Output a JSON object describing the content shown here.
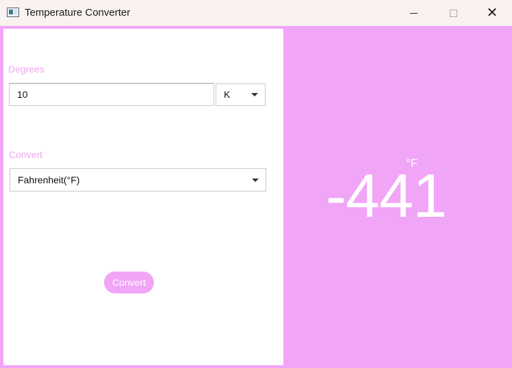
{
  "window": {
    "title": "Temperature Converter",
    "icon": "app-window-icon",
    "accent_color": "#f1a5f7"
  },
  "form": {
    "degrees_label": "Degrees",
    "degrees_value": "10",
    "source_unit": "K",
    "convert_label": "Convert",
    "target_unit": "Fahrenheit(°F)",
    "convert_button": "Convert"
  },
  "result": {
    "unit": "°F",
    "value": "-441"
  }
}
